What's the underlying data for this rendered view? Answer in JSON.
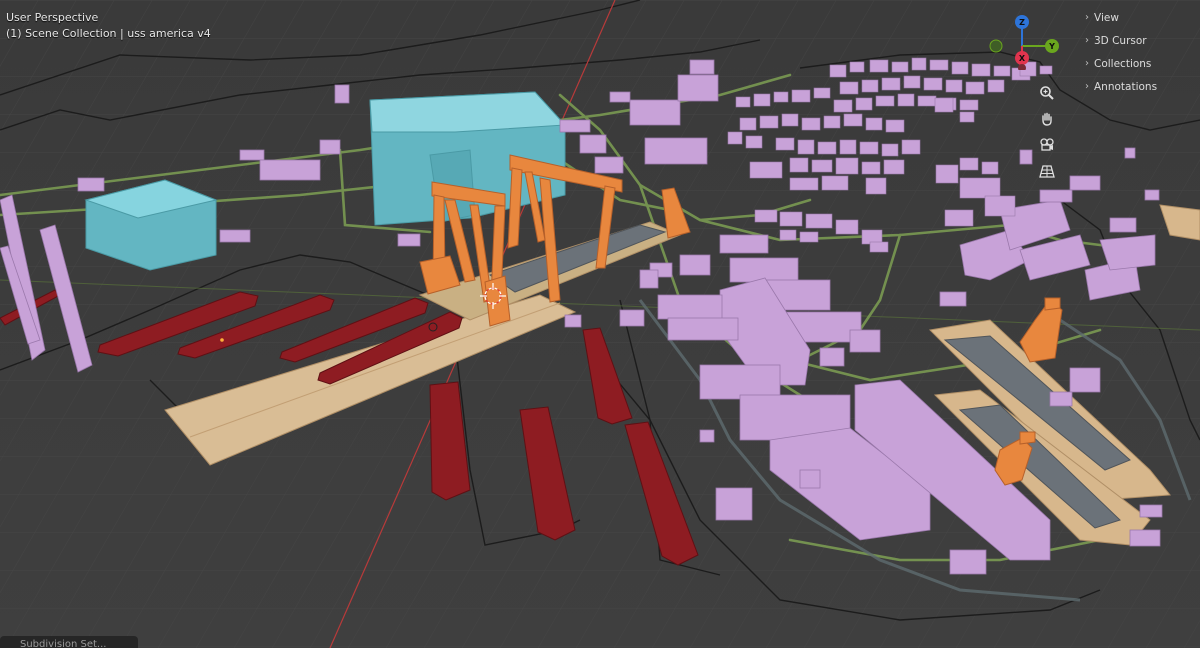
{
  "viewport": {
    "perspective_label": "User Perspective",
    "collection_label": "(1) Scene Collection | uss america v4"
  },
  "sidebar": {
    "tabs": [
      {
        "label": "View"
      },
      {
        "label": "3D Cursor"
      },
      {
        "label": "Collections"
      },
      {
        "label": "Annotations"
      }
    ]
  },
  "gizmo": {
    "axes": [
      {
        "label": "Z",
        "color": "#2d74d9"
      },
      {
        "label": "Y",
        "color": "#6aa61e"
      },
      {
        "label": "X",
        "color": "#e0344e"
      }
    ]
  },
  "nav_buttons": [
    {
      "icon": "zoom-icon"
    },
    {
      "icon": "hand-pan-icon"
    },
    {
      "icon": "camera-icon"
    },
    {
      "icon": "perspective-grid-icon"
    }
  ],
  "modifier_panel": {
    "label": "Subdivision Set..."
  },
  "colors": {
    "background": "#3c3c3c",
    "building": "#c8a2d8",
    "hangar": "#6fc3cf",
    "crane": "#e8873e",
    "ship": "#8e1c22",
    "drydock": "#d8b990",
    "road": "#7a9a52"
  }
}
